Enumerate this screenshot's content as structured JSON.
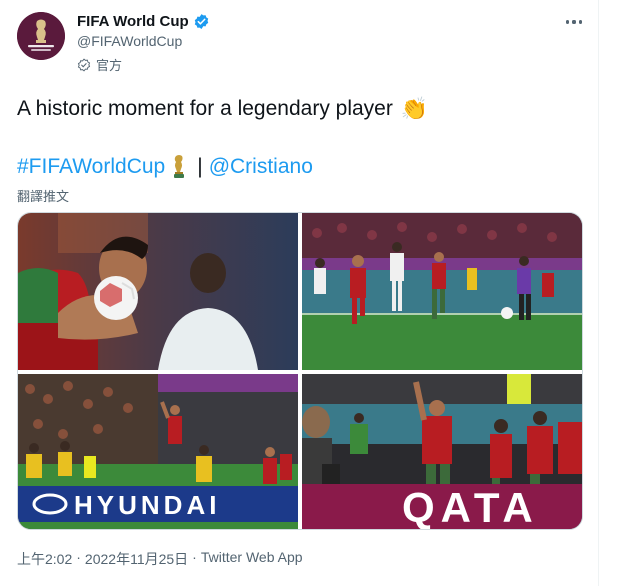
{
  "account": {
    "display_name": "FIFA World Cup",
    "handle": "@FIFAWorldCup",
    "official_label": "官方",
    "avatar_text": "FIFA WORLD CUP Qatar 2022"
  },
  "tweet": {
    "text": "A historic moment for a legendary player",
    "text_emoji": "👏",
    "hashtag": "#FIFAWorldCup",
    "separator": "|",
    "mention": "@Cristiano",
    "translate_label": "翻譯推文"
  },
  "media": {
    "billboard_1": "HYUNDAI",
    "billboard_2": "QATA"
  },
  "meta": {
    "time": "上午2:02",
    "dot1": "·",
    "date": "2022年11月25日",
    "dot2": "·",
    "source": "Twitter Web App"
  },
  "colors": {
    "link": "#1d9bf0",
    "verified": "#1d9bf0",
    "secondary_text": "#536471",
    "avatar_bg": "#5a1a3c"
  },
  "icons": [
    "verified-badge-icon",
    "official-badge-icon",
    "more-icon",
    "clap-emoji-icon",
    "trophy-emoji-icon"
  ]
}
